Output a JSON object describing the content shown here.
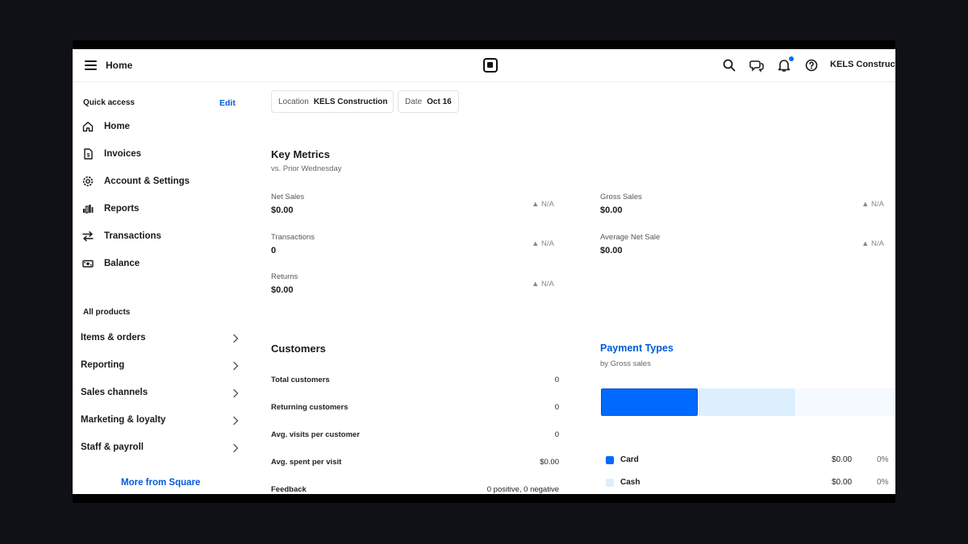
{
  "header": {
    "title": "Home",
    "account": "KELS Constructio"
  },
  "sidebar": {
    "quick_access": {
      "title": "Quick access",
      "edit_label": "Edit",
      "items": [
        {
          "label": "Home",
          "icon": "home-icon"
        },
        {
          "label": "Invoices",
          "icon": "invoice-icon"
        },
        {
          "label": "Account & Settings",
          "icon": "gear-icon"
        },
        {
          "label": "Reports",
          "icon": "bar-chart-icon"
        },
        {
          "label": "Transactions",
          "icon": "transfer-arrows-icon"
        },
        {
          "label": "Balance",
          "icon": "cash-icon"
        }
      ]
    },
    "all_products": {
      "title": "All products",
      "items": [
        {
          "label": "Items & orders"
        },
        {
          "label": "Reporting"
        },
        {
          "label": "Sales channels"
        },
        {
          "label": "Marketing & loyalty"
        },
        {
          "label": "Staff & payroll"
        }
      ]
    },
    "more_label": "More from Square"
  },
  "filters": {
    "location": {
      "label": "Location",
      "value": "KELS Construction"
    },
    "date": {
      "label": "Date",
      "value": "Oct 16"
    }
  },
  "key_metrics": {
    "title": "Key Metrics",
    "subtitle": "vs. Prior Wednesday",
    "metrics": [
      {
        "label": "Net Sales",
        "value": "$0.00",
        "change": "N/A"
      },
      {
        "label": "Gross Sales",
        "value": "$0.00",
        "change": "N/A"
      },
      {
        "label": "Transactions",
        "value": "0",
        "change": "N/A"
      },
      {
        "label": "Average Net Sale",
        "value": "$0.00",
        "change": "N/A"
      },
      {
        "label": "Returns",
        "value": "$0.00",
        "change": "N/A"
      }
    ]
  },
  "customers": {
    "title": "Customers",
    "rows": [
      {
        "label": "Total customers",
        "value": "0"
      },
      {
        "label": "Returning customers",
        "value": "0"
      },
      {
        "label": "Avg. visits per customer",
        "value": "0"
      },
      {
        "label": "Avg. spent per visit",
        "value": "$0.00"
      },
      {
        "label": "Feedback",
        "value": "0 positive, 0 negative"
      }
    ]
  },
  "payment_types": {
    "title": "Payment Types",
    "subtitle": "by Gross sales",
    "colors": {
      "card": "#006aff",
      "cash": "#dcefff",
      "other": "#f4faff"
    },
    "legend": [
      {
        "label": "Card",
        "amount": "$0.00",
        "percent": "0%"
      },
      {
        "label": "Cash",
        "amount": "$0.00",
        "percent": "0%"
      }
    ]
  }
}
